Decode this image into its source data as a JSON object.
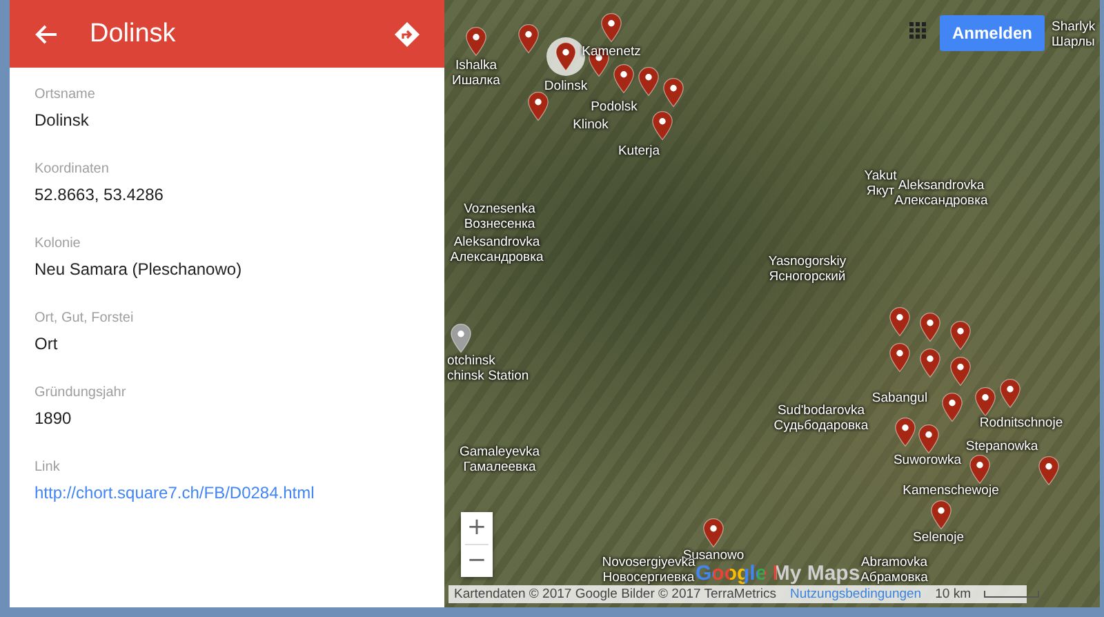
{
  "panel": {
    "title": "Dolinsk",
    "fields": [
      {
        "kind": "text",
        "label": "Ortsname",
        "value": "Dolinsk"
      },
      {
        "kind": "text",
        "label": "Koordinaten",
        "value": "52.8663, 53.4286"
      },
      {
        "kind": "text",
        "label": "Kolonie",
        "value": "Neu Samara (Pleschanowo)"
      },
      {
        "kind": "text",
        "label": "Ort, Gut, Forstei",
        "value": "Ort"
      },
      {
        "kind": "text",
        "label": "Gründungsjahr",
        "value": "1890"
      },
      {
        "kind": "link",
        "label": "Link",
        "value": "http://chort.square7.ch/FB/D0284.html"
      }
    ]
  },
  "map": {
    "sign_in_button": "Anmelden",
    "zoom_in": "+",
    "zoom_out": "−",
    "logo": "Google My Maps",
    "labels": [
      {
        "lines": [
          "Ishalka",
          "Ишалка"
        ]
      },
      {
        "lines": [
          "Kamenetz"
        ]
      },
      {
        "lines": [
          "Dolinsk"
        ]
      },
      {
        "lines": [
          "Podolsk"
        ]
      },
      {
        "lines": [
          "Klinok"
        ]
      },
      {
        "lines": [
          "Kuterja"
        ]
      },
      {
        "lines": [
          "Yakut",
          "Якут"
        ]
      },
      {
        "lines": [
          "Aleksandrovka",
          "Александровка"
        ]
      },
      {
        "lines": [
          "Voznesenka",
          "Вознесенка"
        ]
      },
      {
        "lines": [
          "Aleksandrovka",
          "Александровка"
        ]
      },
      {
        "lines": [
          "Yasnogorskiy",
          "Ясногорский"
        ]
      },
      {
        "lines": [
          "otchinsk",
          "chinsk Station"
        ]
      },
      {
        "lines": [
          "Sabangul"
        ]
      },
      {
        "lines": [
          "Sud'bodarovka",
          "Судьбодаровка"
        ]
      },
      {
        "lines": [
          "Rodnitschnoje"
        ]
      },
      {
        "lines": [
          "Gamaleyevka",
          "Гамалеевка"
        ]
      },
      {
        "lines": [
          "Suworowka"
        ]
      },
      {
        "lines": [
          "Stepanowka"
        ]
      },
      {
        "lines": [
          "Kamenschewoje"
        ]
      },
      {
        "lines": [
          "Selenoje"
        ]
      },
      {
        "lines": [
          "Susanowo"
        ]
      },
      {
        "lines": [
          "Novosergiyevka",
          "Новосергиевка"
        ]
      },
      {
        "lines": [
          "Abramovka",
          "Абрамовка"
        ]
      },
      {
        "lines": [
          "Sharlyk",
          "Шарлы"
        ]
      }
    ],
    "pins": [
      {
        "kind": "place",
        "selected": false
      },
      {
        "kind": "place",
        "selected": false
      },
      {
        "kind": "place",
        "selected": false
      },
      {
        "kind": "place",
        "selected": true
      },
      {
        "kind": "place",
        "selected": false
      },
      {
        "kind": "place",
        "selected": false
      },
      {
        "kind": "place",
        "selected": false
      },
      {
        "kind": "place",
        "selected": false
      },
      {
        "kind": "place",
        "selected": false
      },
      {
        "kind": "place",
        "selected": false
      },
      {
        "kind": "station",
        "selected": false
      },
      {
        "kind": "place",
        "selected": false
      },
      {
        "kind": "place",
        "selected": false
      },
      {
        "kind": "place",
        "selected": false
      },
      {
        "kind": "place",
        "selected": false
      },
      {
        "kind": "place",
        "selected": false
      },
      {
        "kind": "place",
        "selected": false
      },
      {
        "kind": "place",
        "selected": false
      },
      {
        "kind": "place",
        "selected": false
      },
      {
        "kind": "place",
        "selected": false
      },
      {
        "kind": "place",
        "selected": false
      },
      {
        "kind": "place",
        "selected": false
      },
      {
        "kind": "place",
        "selected": false
      },
      {
        "kind": "place",
        "selected": false
      },
      {
        "kind": "place",
        "selected": false
      },
      {
        "kind": "place",
        "selected": false
      }
    ],
    "attribution": "Kartendaten © 2017 Google Bilder © 2017 TerraMetrics",
    "terms_link": "Nutzungsbedingungen",
    "scale": "10 km"
  }
}
